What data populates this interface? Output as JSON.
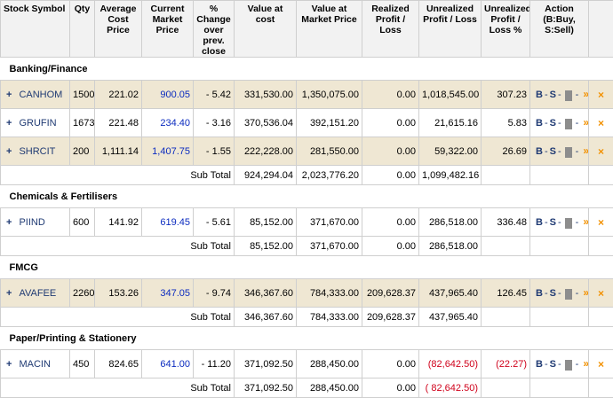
{
  "headers": {
    "symbol": "Stock Symbol",
    "qty": "Qty",
    "avg_cost": "Average Cost Price",
    "cur_price": "Current Market Price",
    "change": "% Change over prev. close",
    "value_cost": "Value at cost",
    "value_market": "Value at Market Price",
    "realized": "Realized Profit / Loss",
    "unrealized": "Unrealized Profit / Loss",
    "unrealized_pct": "Unrealized Profit / Loss %",
    "action": "Action (B:Buy, S:Sell)"
  },
  "actions": {
    "buy": "B",
    "sell": "S",
    "sep": "-",
    "more": "»",
    "delete": "×"
  },
  "subtotal_label": "Sub Total",
  "sectors": [
    {
      "name": "Banking/Finance",
      "rows": [
        {
          "plus": "+",
          "symbol": "CANHOM",
          "qty": "1500",
          "avg": "221.02",
          "cmp": "900.05",
          "chg": "- 5.42",
          "vcost": "331,530.00",
          "vmkt": "1,350,075.00",
          "real": "0.00",
          "unreal": "1,018,545.00",
          "pct": "307.23"
        },
        {
          "plus": "+",
          "symbol": "GRUFIN",
          "qty": "1673",
          "avg": "221.48",
          "cmp": "234.40",
          "chg": "- 3.16",
          "vcost": "370,536.04",
          "vmkt": "392,151.20",
          "real": "0.00",
          "unreal": "21,615.16",
          "pct": "5.83"
        },
        {
          "plus": "+",
          "symbol": "SHRCIT",
          "qty": "200",
          "avg": "1,111.14",
          "cmp": "1,407.75",
          "chg": "- 1.55",
          "vcost": "222,228.00",
          "vmkt": "281,550.00",
          "real": "0.00",
          "unreal": "59,322.00",
          "pct": "26.69"
        }
      ],
      "subtotal": {
        "vcost": "924,294.04",
        "vmkt": "2,023,776.20",
        "real": "0.00",
        "unreal": "1,099,482.16"
      }
    },
    {
      "name": "Chemicals & Fertilisers",
      "rows": [
        {
          "plus": "+",
          "symbol": "PIIND",
          "qty": "600",
          "avg": "141.92",
          "cmp": "619.45",
          "chg": "- 5.61",
          "vcost": "85,152.00",
          "vmkt": "371,670.00",
          "real": "0.00",
          "unreal": "286,518.00",
          "pct": "336.48"
        }
      ],
      "subtotal": {
        "vcost": "85,152.00",
        "vmkt": "371,670.00",
        "real": "0.00",
        "unreal": "286,518.00"
      }
    },
    {
      "name": "FMCG",
      "rows": [
        {
          "plus": "+",
          "symbol": "AVAFEE",
          "qty": "2260",
          "avg": "153.26",
          "cmp": "347.05",
          "chg": "- 9.74",
          "vcost": "346,367.60",
          "vmkt": "784,333.00",
          "real": "209,628.37",
          "unreal": "437,965.40",
          "pct": "126.45"
        }
      ],
      "subtotal": {
        "vcost": "346,367.60",
        "vmkt": "784,333.00",
        "real": "209,628.37",
        "unreal": "437,965.40"
      }
    },
    {
      "name": "Paper/Printing & Stationery",
      "rows": [
        {
          "plus": "+",
          "symbol": "MACIN",
          "qty": "450",
          "avg": "824.65",
          "cmp": "641.00",
          "chg": "- 11.20",
          "vcost": "371,092.50",
          "vmkt": "288,450.00",
          "real": "0.00",
          "unreal": "(82,642.50)",
          "pct": "(22.27)",
          "negative": true
        }
      ],
      "subtotal": {
        "vcost": "371,092.50",
        "vmkt": "288,450.00",
        "real": "0.00",
        "unreal": "( 82,642.50)",
        "negative": true
      }
    }
  ]
}
